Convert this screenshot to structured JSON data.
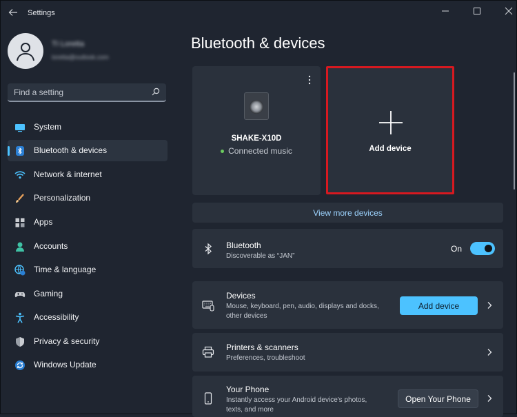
{
  "app": {
    "title": "Settings"
  },
  "user": {
    "name": "TI Loretta",
    "email": "loretta@outlook.com"
  },
  "search": {
    "placeholder": "Find a setting"
  },
  "nav": {
    "items": [
      {
        "label": "System",
        "icon": "monitor-icon",
        "active": false
      },
      {
        "label": "Bluetooth & devices",
        "icon": "bluetooth-icon",
        "active": true
      },
      {
        "label": "Network & internet",
        "icon": "wifi-icon",
        "active": false
      },
      {
        "label": "Personalization",
        "icon": "brush-icon",
        "active": false
      },
      {
        "label": "Apps",
        "icon": "apps-icon",
        "active": false
      },
      {
        "label": "Accounts",
        "icon": "person-icon",
        "active": false
      },
      {
        "label": "Time & language",
        "icon": "globe-clock-icon",
        "active": false
      },
      {
        "label": "Gaming",
        "icon": "gamepad-icon",
        "active": false
      },
      {
        "label": "Accessibility",
        "icon": "accessibility-icon",
        "active": false
      },
      {
        "label": "Privacy & security",
        "icon": "shield-icon",
        "active": false
      },
      {
        "label": "Windows Update",
        "icon": "update-icon",
        "active": false
      }
    ]
  },
  "page": {
    "title": "Bluetooth & devices"
  },
  "device_card": {
    "name": "SHAKE-X10D",
    "status": "Connected music"
  },
  "add_card": {
    "label": "Add device"
  },
  "more_devices": {
    "label": "View more devices"
  },
  "bluetooth": {
    "title": "Bluetooth",
    "subtitle": "Discoverable as “JAN”",
    "toggle_label": "On",
    "enabled": true
  },
  "devices_row": {
    "title": "Devices",
    "subtitle_line1": "Mouse, keyboard, pen, audio, displays and docks,",
    "subtitle_line2": "other devices",
    "button": "Add device"
  },
  "printers_row": {
    "title": "Printers & scanners",
    "subtitle": "Preferences, troubleshoot"
  },
  "phone_row": {
    "title": "Your Phone",
    "subtitle_line1": "Instantly access your Android device's photos,",
    "subtitle_line2": "texts, and more",
    "button": "Open Your Phone"
  },
  "colors": {
    "background": "#1f2530",
    "card": "#2a313c",
    "accent": "#4cc2ff",
    "highlight_border": "#d71920",
    "status_green": "#6ccb5f"
  }
}
